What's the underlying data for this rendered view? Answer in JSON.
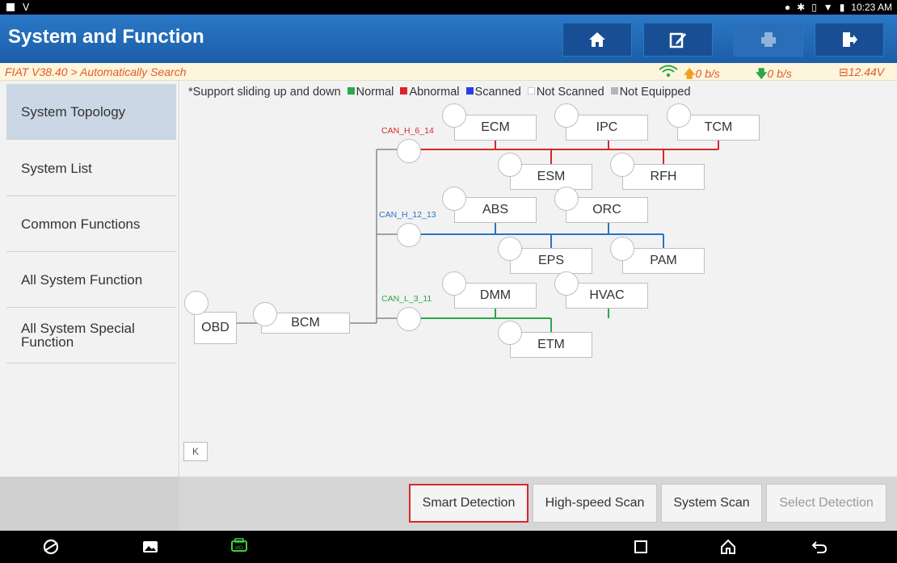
{
  "status_bar": {
    "time": "10:23 AM"
  },
  "header": {
    "title": "System and Function",
    "buttons": [
      "home-icon",
      "edit-icon",
      "print-icon",
      "exit-icon"
    ]
  },
  "breadcrumb": {
    "path": "FIAT V38.40 > Automatically Search",
    "upload_rate": "0 b/s",
    "download_rate": "0 b/s",
    "voltage": "12.44V"
  },
  "sidebar": {
    "items": [
      {
        "label": "System Topology",
        "active": true
      },
      {
        "label": "System List",
        "active": false
      },
      {
        "label": "Common Functions",
        "active": false
      },
      {
        "label": "All System Function",
        "active": false
      },
      {
        "label": "All System Special Function",
        "active": false
      }
    ]
  },
  "legend": {
    "note": "*Support sliding up and down",
    "items": [
      {
        "label": "Normal",
        "color": "#2aa84a"
      },
      {
        "label": "Abnormal",
        "color": "#e0202a"
      },
      {
        "label": "Scanned",
        "color": "#2a3fe0"
      },
      {
        "label": "Not Scanned",
        "color": "#ffffff"
      },
      {
        "label": "Not Equipped",
        "color": "#b5b5b5"
      }
    ]
  },
  "topology": {
    "root": "OBD",
    "gateway": "BCM",
    "buses": [
      {
        "name": "CAN_H_6_14",
        "color": "#d9262c",
        "top_nodes": [
          "ECM",
          "IPC",
          "TCM"
        ],
        "bottom_nodes": [
          "ESM",
          "RFH"
        ]
      },
      {
        "name": "CAN_H_12_13",
        "color": "#2a72c9",
        "top_nodes": [
          "ABS",
          "ORC"
        ],
        "bottom_nodes": [
          "EPS",
          "PAM"
        ]
      },
      {
        "name": "CAN_L_3_11",
        "color": "#2aa84a",
        "top_nodes": [
          "DMM",
          "HVAC"
        ],
        "bottom_nodes": [
          "ETM"
        ]
      }
    ],
    "collapse_label": "K"
  },
  "footer": {
    "buttons": [
      {
        "label": "Smart Detection",
        "highlighted": true,
        "enabled": true
      },
      {
        "label": "High-speed Scan",
        "highlighted": false,
        "enabled": true
      },
      {
        "label": "System Scan",
        "highlighted": false,
        "enabled": true
      },
      {
        "label": "Select Detection",
        "highlighted": false,
        "enabled": false
      }
    ]
  },
  "nav_bar": {
    "icons": [
      "browser-icon",
      "gallery-icon",
      "vci-icon",
      "recents-icon",
      "home-icon",
      "back-icon"
    ]
  }
}
